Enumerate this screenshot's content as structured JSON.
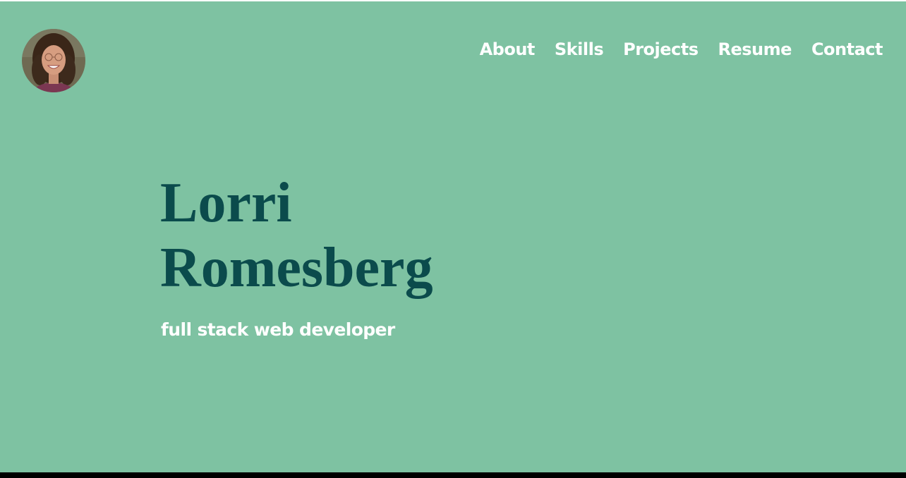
{
  "nav": {
    "items": [
      {
        "label": "About"
      },
      {
        "label": "Skills"
      },
      {
        "label": "Projects"
      },
      {
        "label": "Resume"
      },
      {
        "label": "Contact"
      }
    ]
  },
  "hero": {
    "name_line1": "Lorri",
    "name_line2": "Romesberg",
    "tagline": "full stack web developer"
  },
  "colors": {
    "background": "#7ec2a2",
    "name": "#0b4b4c",
    "nav_text": "#ffffff",
    "bottom_bar": "#000000"
  }
}
